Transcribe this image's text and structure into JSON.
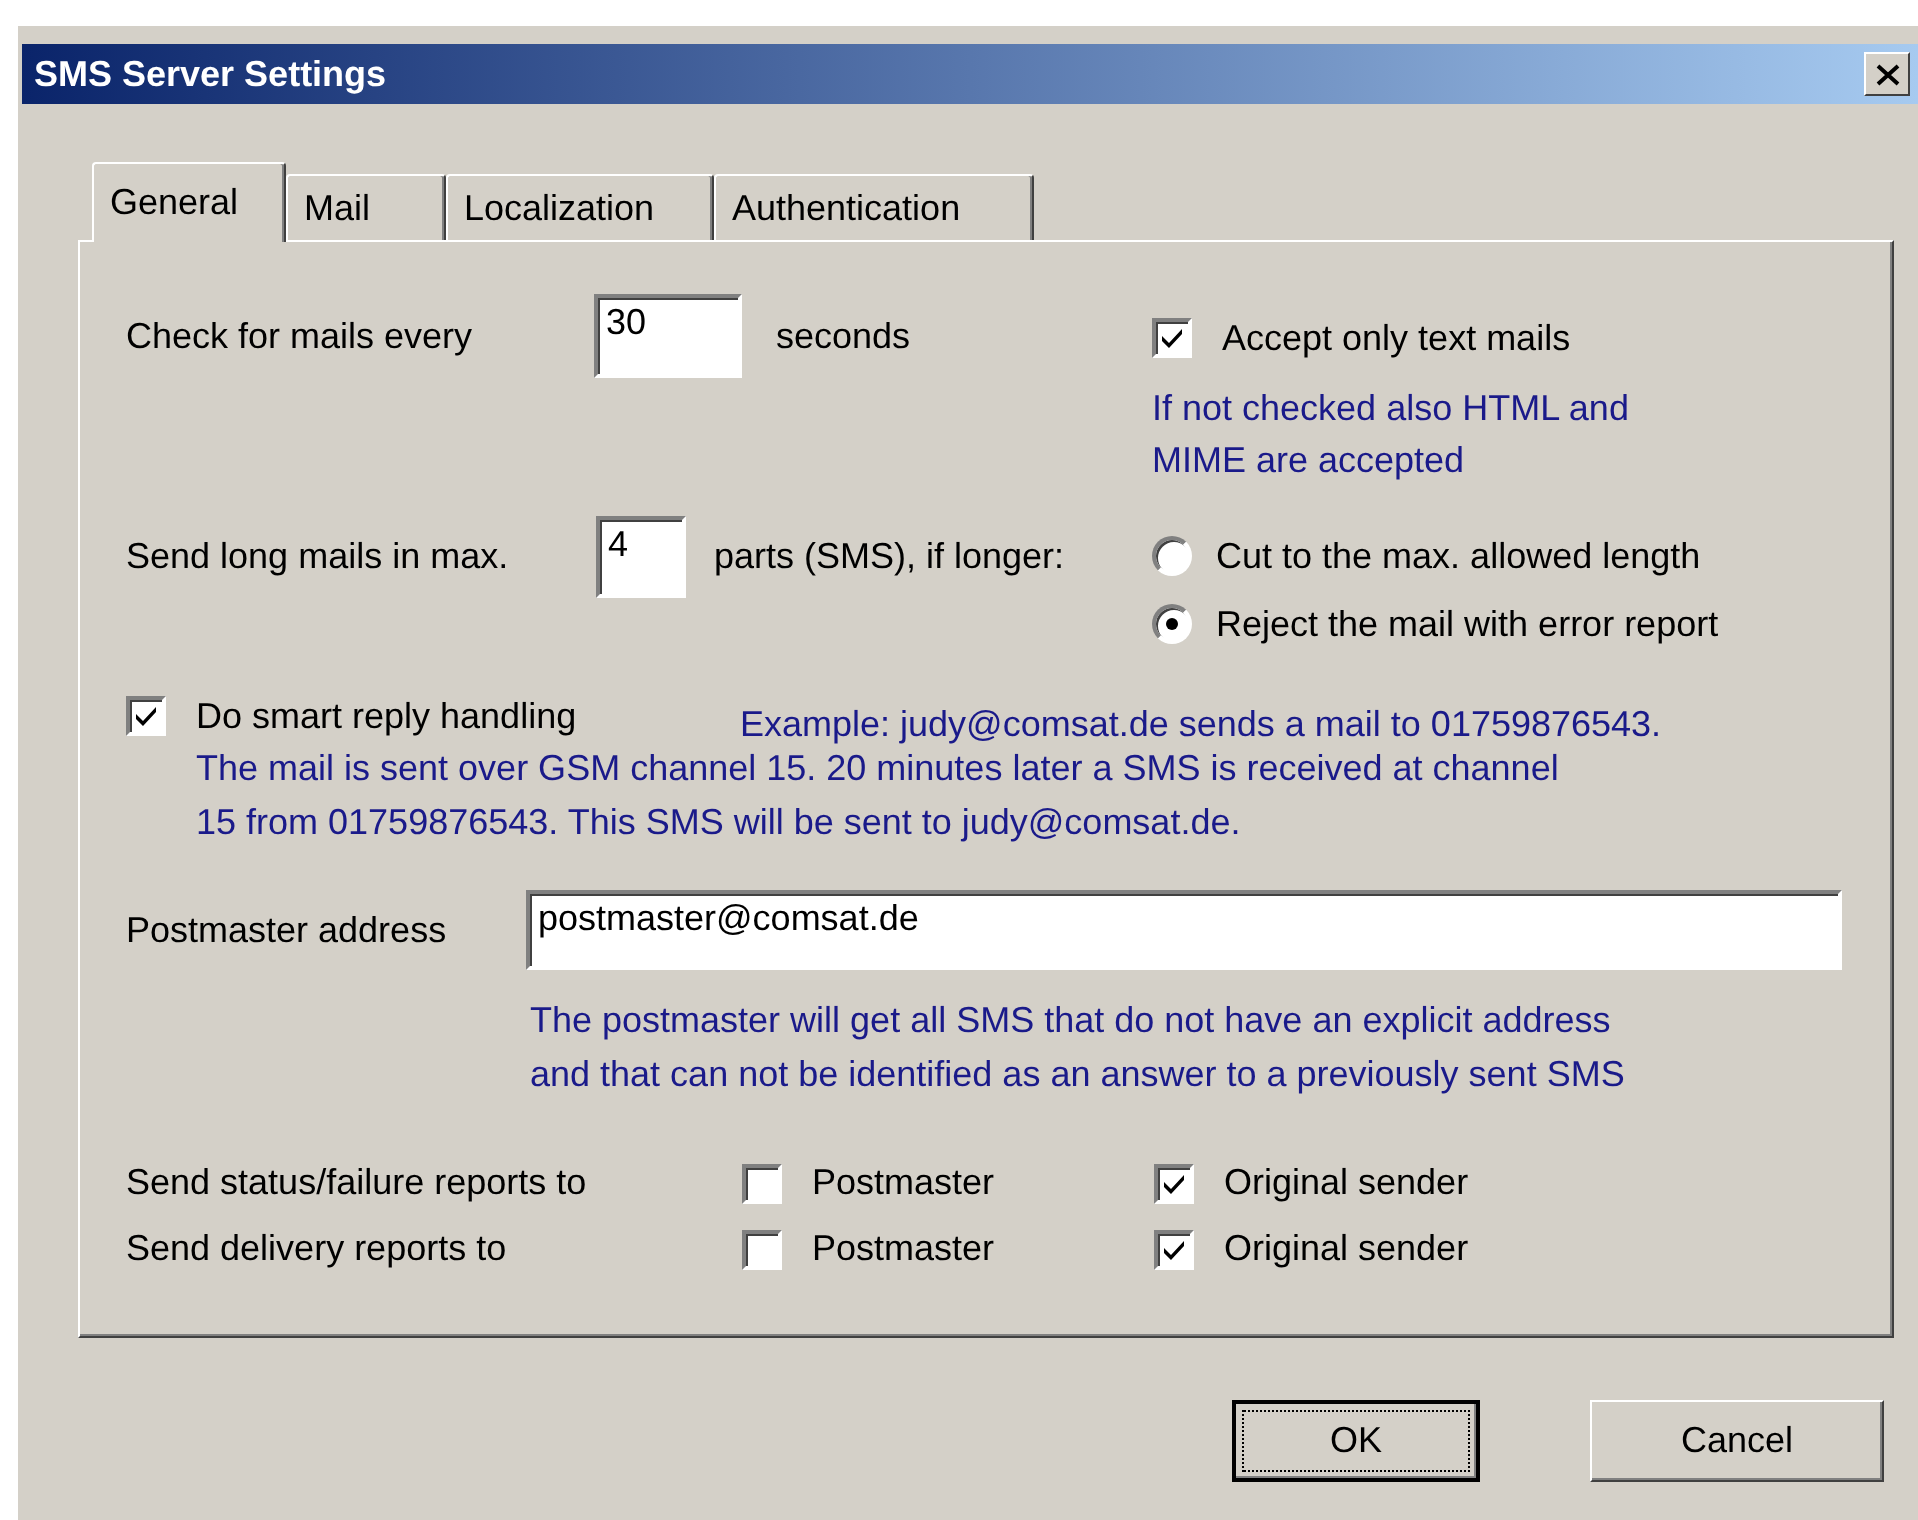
{
  "window": {
    "title": "SMS Server Settings"
  },
  "tabs": [
    {
      "label": "General",
      "selected": true
    },
    {
      "label": "Mail",
      "selected": false
    },
    {
      "label": "Localization",
      "selected": false
    },
    {
      "label": "Authentication",
      "selected": false
    }
  ],
  "check_interval": {
    "label": "Check for mails every",
    "value": "30",
    "unit": "seconds"
  },
  "text_only": {
    "label": "Accept only text mails",
    "checked": true,
    "note": "If not checked also HTML and\nMIME are accepted"
  },
  "long_mails": {
    "label": "Send long mails in max.",
    "value": "4",
    "unit": "parts (SMS), if longer:",
    "options": [
      {
        "label": "Cut to the max. allowed length",
        "selected": false
      },
      {
        "label": "Reject the mail with error report",
        "selected": true
      }
    ]
  },
  "smart_reply": {
    "label": "Do smart reply handling",
    "checked": true,
    "example": "Example: judy@comsat.de sends a mail to 01759876543.",
    "details": "The mail is sent over GSM channel 15. 20 minutes later a SMS is received at channel\n15 from 01759876543. This SMS will be sent to judy@comsat.de."
  },
  "postmaster": {
    "label": "Postmaster address",
    "value": "postmaster@comsat.de",
    "note": "The postmaster will get all SMS that do not have an explicit address\nand that can not be identified as an answer to a previously sent SMS"
  },
  "reports": [
    {
      "label": "Send status/failure reports to",
      "options": [
        {
          "label": "Postmaster",
          "checked": false
        },
        {
          "label": "Original sender",
          "checked": true
        }
      ]
    },
    {
      "label": "Send delivery reports to",
      "options": [
        {
          "label": "Postmaster",
          "checked": false
        },
        {
          "label": "Original sender",
          "checked": true
        }
      ]
    }
  ],
  "buttons": [
    {
      "label": "OK",
      "default": true
    },
    {
      "label": "Cancel",
      "default": false
    }
  ]
}
